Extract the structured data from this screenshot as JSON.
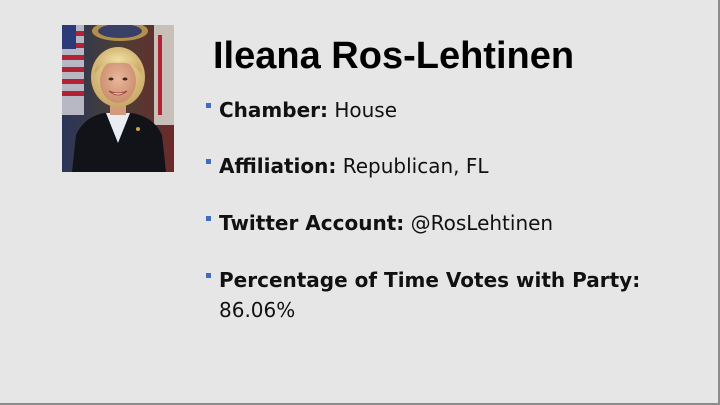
{
  "slide": {
    "title": "Ileana Ros-Lehtinen",
    "portrait_icon": "member-portrait-photo",
    "bullet_color": "#3d6dbf",
    "bullets": [
      {
        "label": "Chamber:",
        "value": " House"
      },
      {
        "label": "Affiliation:",
        "value": " Republican, FL"
      },
      {
        "label": "Twitter Account:",
        "value": " @RosLehtinen"
      },
      {
        "label": "Percentage of Time Votes with Party:",
        "value": "86.06%"
      }
    ]
  }
}
